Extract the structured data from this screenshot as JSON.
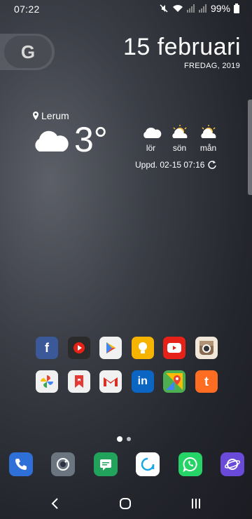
{
  "status_bar": {
    "time": "07:22",
    "battery_percent": "99%",
    "icons": [
      "mute-icon",
      "wifi-icon",
      "signal-icon",
      "signal-icon",
      "battery-icon"
    ]
  },
  "search_widget": {
    "letter": "G"
  },
  "date_widget": {
    "date": "15 februari",
    "weekday_year": "FREDAG, 2019"
  },
  "weather": {
    "location": "Lerum",
    "temperature": "3°",
    "forecast": [
      {
        "day": "lör",
        "icon": "cloud-icon"
      },
      {
        "day": "sön",
        "icon": "partly-sunny-icon"
      },
      {
        "day": "mån",
        "icon": "partly-sunny-icon"
      }
    ],
    "updated": "Uppd. 02-15 07:16"
  },
  "apps": {
    "row1": [
      {
        "name": "facebook",
        "glyph": "f",
        "color": "#3b5998"
      },
      {
        "name": "youtube-music",
        "glyph": "",
        "color": "#2b2b2b"
      },
      {
        "name": "play-store",
        "glyph": "",
        "color": "#f1f1f1"
      },
      {
        "name": "keep",
        "glyph": "",
        "color": "#f6b400"
      },
      {
        "name": "youtube",
        "glyph": "",
        "color": "#e62117"
      },
      {
        "name": "instagram",
        "glyph": "",
        "color": "#8a6a4f"
      }
    ],
    "row2": [
      {
        "name": "photos",
        "glyph": "",
        "color": "#f1f1f1"
      },
      {
        "name": "bookmark-app",
        "glyph": "",
        "color": "#f1f1f1"
      },
      {
        "name": "gmail",
        "glyph": "",
        "color": "#f1f1f1"
      },
      {
        "name": "linkedin",
        "glyph": "in",
        "color": "#0a66c2"
      },
      {
        "name": "maps",
        "glyph": "",
        "color": "#4caf50"
      },
      {
        "name": "tumblr-like",
        "glyph": "t",
        "color": "#ff6d22"
      }
    ]
  },
  "dock": [
    {
      "name": "phone",
      "color": "#2f6fd8"
    },
    {
      "name": "camera",
      "color": "#6b7580"
    },
    {
      "name": "messages",
      "color": "#22a35b"
    },
    {
      "name": "assistant",
      "color": "#ffffff"
    },
    {
      "name": "whatsapp",
      "color": "#25d366"
    },
    {
      "name": "internet",
      "color": "#6a4ad8"
    }
  ],
  "page_indicator": {
    "pages": 2,
    "active": 1
  },
  "nav": {
    "icons": [
      "back-icon",
      "home-icon",
      "recents-icon"
    ]
  }
}
